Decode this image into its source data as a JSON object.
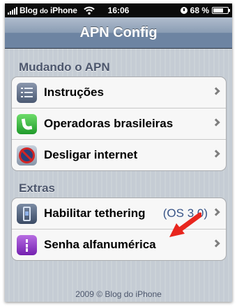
{
  "status_bar": {
    "carrier_part1": "Blog ",
    "carrier_small": "do",
    "carrier_part2": " iPhone",
    "time": "16:06",
    "battery": "68 %",
    "battery_level": 0.68
  },
  "nav": {
    "title": "APN Config"
  },
  "sections": [
    {
      "header": "Mudando o APN",
      "rows": [
        {
          "label": "Instruções",
          "icon": "list-icon"
        },
        {
          "label": "Operadoras brasileiras",
          "icon": "phone-icon"
        },
        {
          "label": "Desligar internet",
          "icon": "no-entry-icon"
        }
      ]
    },
    {
      "header": "Extras",
      "rows": [
        {
          "label": "Habilitar tethering",
          "detail": "(OS 3.0)",
          "icon": "tethering-icon"
        },
        {
          "label": "Senha alfanumérica",
          "icon": "password-icon"
        }
      ]
    }
  ],
  "footer": "2009 © Blog do iPhone",
  "colors": {
    "section_header": "#4c566c",
    "detail_text": "#385487",
    "annotation_arrow": "#e8261e"
  }
}
